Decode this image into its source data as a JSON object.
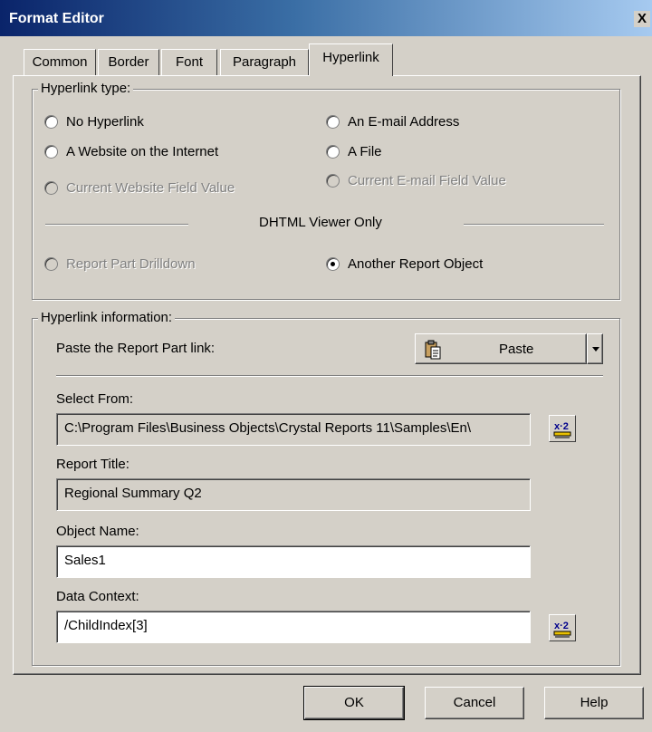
{
  "window": {
    "title": "Format Editor",
    "close_label": "X"
  },
  "tabs": [
    {
      "label": "Common"
    },
    {
      "label": "Border"
    },
    {
      "label": "Font"
    },
    {
      "label": "Paragraph"
    },
    {
      "label": "Hyperlink"
    }
  ],
  "hyperlink_type": {
    "legend": "Hyperlink type:",
    "options": {
      "no_hyperlink": {
        "label": "No Hyperlink",
        "enabled": true,
        "selected": false
      },
      "website": {
        "label": "A Website on the Internet",
        "enabled": true,
        "selected": false
      },
      "current_website": {
        "label": "Current Website Field Value",
        "enabled": false,
        "selected": false
      },
      "email": {
        "label": "An E-mail Address",
        "enabled": true,
        "selected": false
      },
      "file": {
        "label": "A File",
        "enabled": true,
        "selected": false
      },
      "current_email": {
        "label": "Current E-mail Field Value",
        "enabled": false,
        "selected": false
      },
      "drilldown": {
        "label": "Report Part Drilldown",
        "enabled": false,
        "selected": false
      },
      "another_object": {
        "label": "Another Report Object",
        "enabled": true,
        "selected": true
      }
    },
    "dhtml_label": "DHTML Viewer Only"
  },
  "hyperlink_info": {
    "legend": "Hyperlink information:",
    "paste_label": "Paste the Report Part link:",
    "paste_button": "Paste",
    "select_from_label": "Select From:",
    "select_from_value": "C:\\Program Files\\Business Objects\\Crystal Reports 11\\Samples\\En\\",
    "report_title_label": "Report Title:",
    "report_title_value": "Regional Summary Q2",
    "object_name_label": "Object Name:",
    "object_name_value": "Sales1",
    "data_context_label": "Data Context:",
    "data_context_value": "/ChildIndex[3]",
    "formula_icon_text": "x·2"
  },
  "buttons": {
    "ok": "OK",
    "cancel": "Cancel",
    "help": "Help"
  }
}
